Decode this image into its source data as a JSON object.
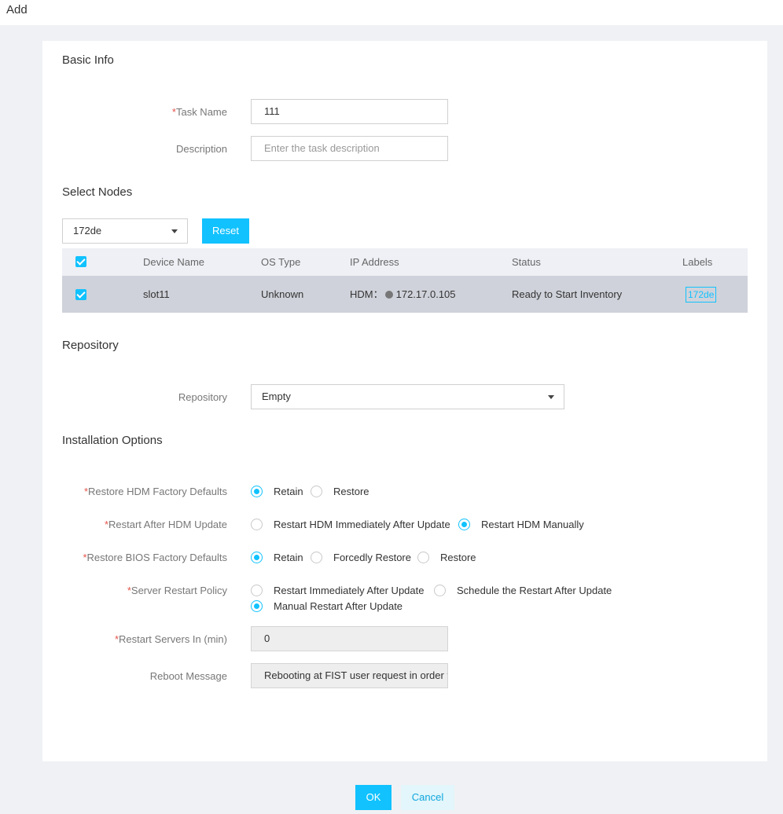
{
  "window": {
    "title": "Add"
  },
  "basic_info": {
    "section_title": "Basic Info",
    "task_name": {
      "required_mark": "*",
      "label": "Task Name",
      "value": "111"
    },
    "description": {
      "label": "Description",
      "placeholder": "Enter the task description",
      "value": ""
    }
  },
  "select_nodes": {
    "section_title": "Select Nodes",
    "label_filter": {
      "selected": "172de"
    },
    "reset_label": "Reset",
    "table": {
      "columns": [
        "Device Name",
        "OS Type",
        "IP Address",
        "Status",
        "Labels"
      ],
      "header_checked": true,
      "rows": [
        {
          "checked": true,
          "device_name": "slot11",
          "os_type": "Unknown",
          "ip_prefix": "HDM：",
          "ip_address": "172.17.0.105",
          "status": "Ready to Start Inventory",
          "label": "172de"
        }
      ]
    }
  },
  "repository": {
    "section_title": "Repository",
    "label": "Repository",
    "selected": "Empty"
  },
  "installation_options": {
    "section_title": "Installation Options",
    "restore_hdm": {
      "required_mark": "*",
      "label": "Restore HDM Factory Defaults",
      "options": [
        "Retain",
        "Restore"
      ],
      "selected": "Retain"
    },
    "restart_after_hdm": {
      "required_mark": "*",
      "label": "Restart After HDM Update",
      "options": [
        "Restart HDM Immediately After Update",
        "Restart HDM Manually"
      ],
      "selected": "Restart HDM Manually"
    },
    "restore_bios": {
      "required_mark": "*",
      "label": "Restore BIOS Factory Defaults",
      "options": [
        "Retain",
        "Forcedly Restore",
        "Restore"
      ],
      "selected": "Retain"
    },
    "server_restart_policy": {
      "required_mark": "*",
      "label": "Server Restart Policy",
      "options": [
        "Restart Immediately After Update",
        "Schedule the Restart After Update",
        "Manual Restart After Update"
      ],
      "selected": "Manual Restart After Update"
    },
    "restart_servers_in": {
      "required_mark": "*",
      "label": "Restart Servers In (min)",
      "value": "0"
    },
    "reboot_message": {
      "label": "Reboot Message",
      "value": "Rebooting at FIST user request in order to complete the firmware update"
    }
  },
  "footer": {
    "ok_label": "OK",
    "cancel_label": "Cancel"
  },
  "colors": {
    "accent": "#11c2ff",
    "required": "#e5534b",
    "page_bg": "#f0f1f4",
    "selected_row": "#cfd2da"
  }
}
